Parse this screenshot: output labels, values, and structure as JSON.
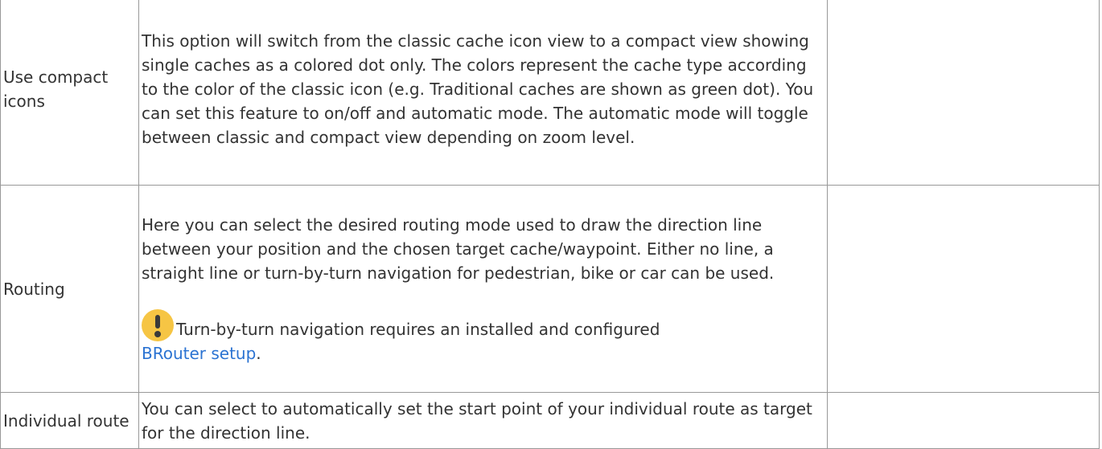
{
  "rows": [
    {
      "name": "Use compact icons",
      "description": "This option will switch from the classic cache icon view to a compact view showing single caches as a colored dot only. The colors represent the cache type according to the color of the classic icon (e.g. Traditional caches are shown as green dot). You can set this feature to on/off and automatic mode. The automatic mode will toggle between classic and compact view depending on zoom level.",
      "extra": ""
    },
    {
      "name": "Routing",
      "description": "Here you can select the desired routing mode used to draw the direction line between your position and the chosen target cache/waypoint. Either no line, a straight line or turn-by-turn navigation for pedestrian, bike or car can be used.",
      "note": {
        "icon": "exclamation-icon",
        "text": "Turn-by-turn navigation requires an installed and configured",
        "link_text": "BRouter setup",
        "trailing": "."
      },
      "extra": ""
    },
    {
      "name": "Individual route",
      "description": "You can select to automatically set the start point of your individual route as target for the direction line.",
      "extra": ""
    }
  ],
  "colors": {
    "link": "#2b73d2",
    "icon_fill": "#f6c544",
    "border": "#999999",
    "text": "#333333"
  }
}
